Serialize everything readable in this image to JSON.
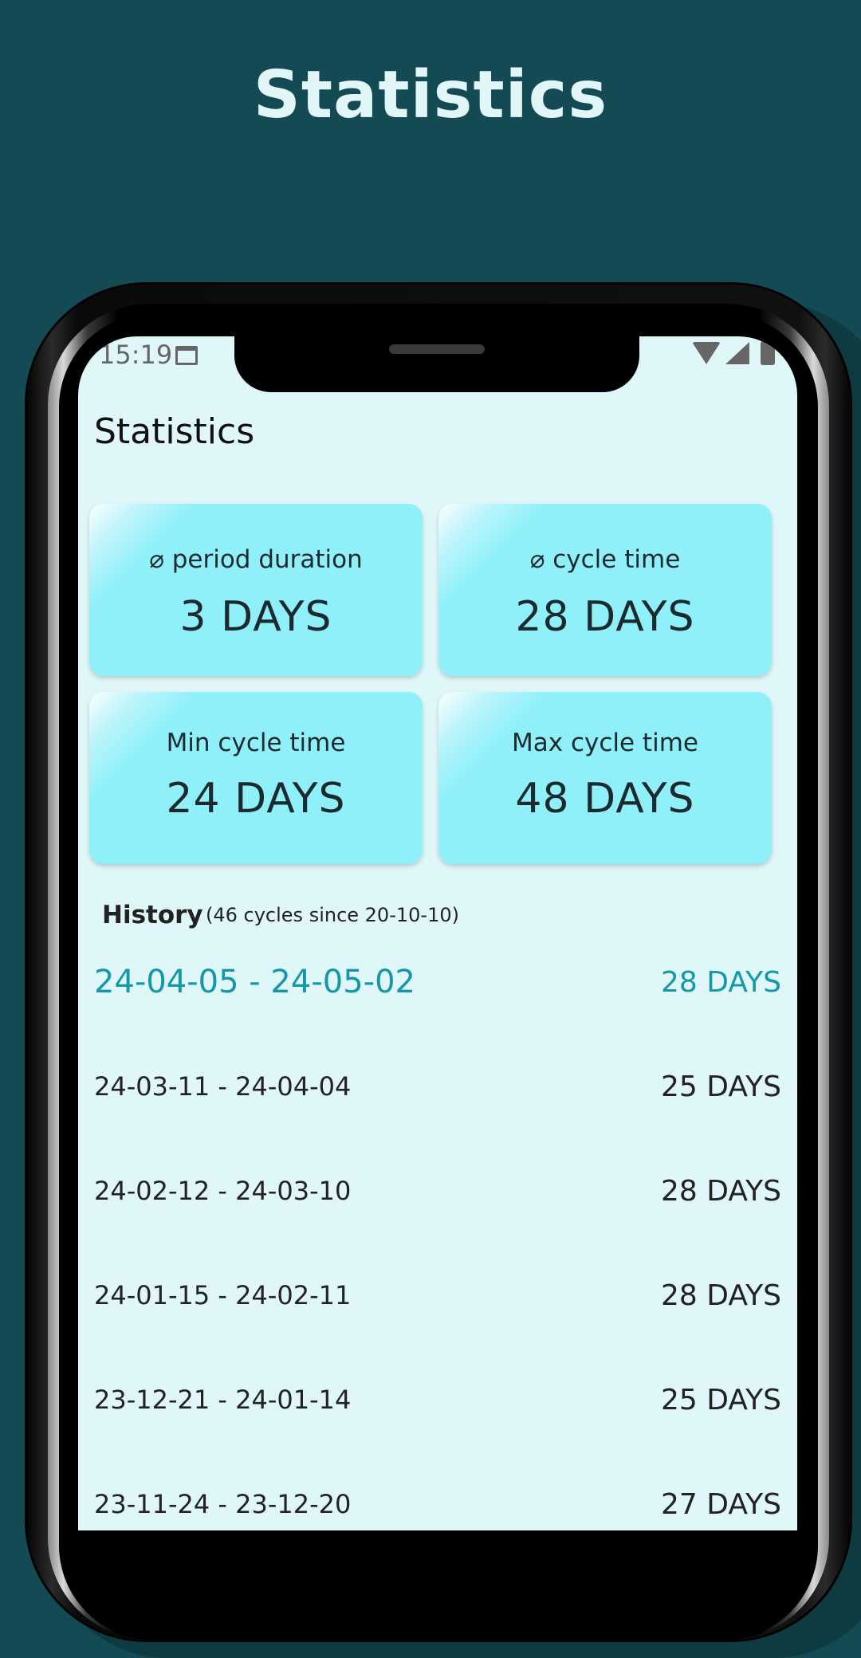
{
  "hero": {
    "title": "Statistics"
  },
  "status_bar": {
    "time": "15:19"
  },
  "app": {
    "title": "Statistics"
  },
  "cards": [
    {
      "label": "⌀ period duration",
      "value": "3 DAYS"
    },
    {
      "label": "⌀ cycle time",
      "value": "28 DAYS"
    },
    {
      "label": "Min cycle time",
      "value": "24 DAYS"
    },
    {
      "label": "Max cycle time",
      "value": "48 DAYS"
    }
  ],
  "history": {
    "label": "History",
    "subtitle": "(46 cycles since 20-10-10)",
    "rows": [
      {
        "range": "24-04-05 - 24-05-02",
        "days": "28 DAYS"
      },
      {
        "range": "24-03-11 - 24-04-04",
        "days": "25 DAYS"
      },
      {
        "range": "24-02-12 - 24-03-10",
        "days": "28 DAYS"
      },
      {
        "range": "24-01-15 - 24-02-11",
        "days": "28 DAYS"
      },
      {
        "range": "23-12-21 - 24-01-14",
        "days": "25 DAYS"
      },
      {
        "range": "23-11-24 - 23-12-20",
        "days": "27 DAYS"
      }
    ]
  },
  "colors": {
    "background": "#134a53",
    "screen": "#e0f7f9",
    "card": "#8ff0fa",
    "accent": "#1497a7"
  }
}
